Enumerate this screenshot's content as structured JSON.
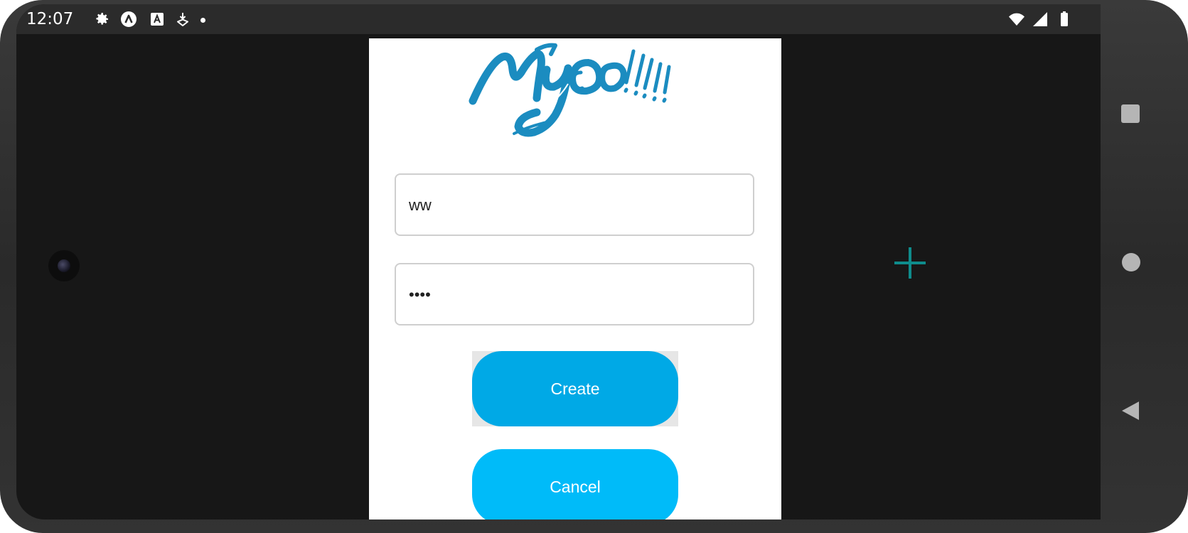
{
  "status_bar": {
    "time": "12:07",
    "icons": [
      "gear-icon",
      "app-a-icon",
      "text-a-icon",
      "download-icon",
      "notification-dot-icon",
      "wifi-icon",
      "signal-icon",
      "battery-icon"
    ]
  },
  "form": {
    "username_value": "ww",
    "password_value": "••••",
    "create_label": "Create",
    "cancel_label": "Cancel"
  },
  "logo": {
    "name": "mygo-logo",
    "text": "Mygo!!!!!"
  },
  "colors": {
    "create_button": "#00a9e6",
    "cancel_button": "#00bbf9",
    "logo": "#1b8cc0",
    "plus_icon": "#0f8c8c",
    "background": "#171717"
  },
  "nav_bar": {
    "icons": [
      "recents-square-icon",
      "home-circle-icon",
      "back-triangle-icon"
    ]
  }
}
